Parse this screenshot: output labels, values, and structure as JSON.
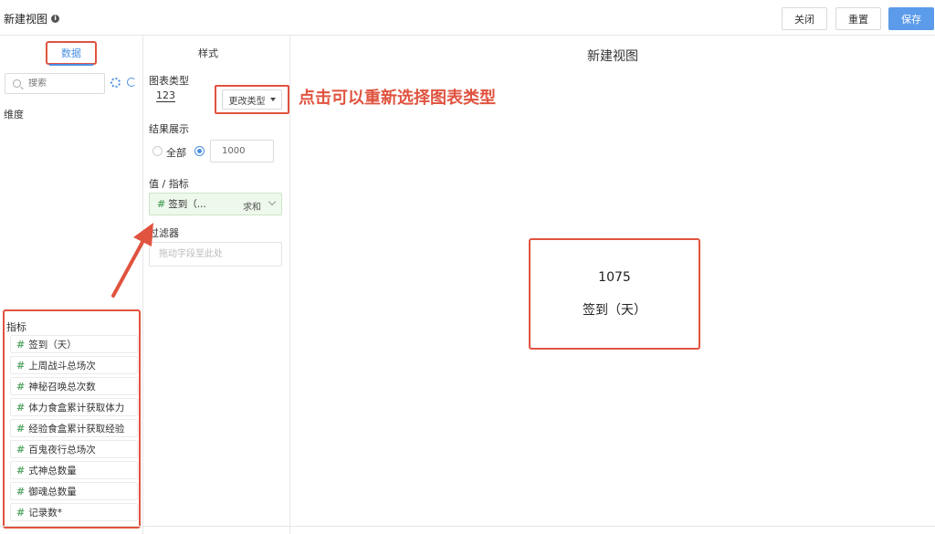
{
  "header": {
    "title": "新建视图",
    "buttons": {
      "close": "关闭",
      "reset": "重置",
      "save": "保存"
    },
    "save_color": "#5b9bea"
  },
  "left_panel": {
    "tab_data": "数据",
    "search_placeholder": "搜索",
    "dimension_label": "维度",
    "metrics_label": "指标",
    "metrics": [
      "签到（天）",
      "上周战斗总场次",
      "神秘召唤总次数",
      "体力食盒累计获取体力",
      "经验食盒累计获取经验",
      "百鬼夜行总场次",
      "式神总数量",
      "御魂总数量",
      "记录数*"
    ]
  },
  "config_panel": {
    "tab_style": "样式",
    "chart_type_label": "图表类型",
    "chart_type_value": "123",
    "change_type_button": "更改类型",
    "result_label": "结果展示",
    "all_option": "全部",
    "limit_value": "1000",
    "value_metric_label": "值 / 指标",
    "value_field": "签到（...",
    "aggregation": "求和",
    "filter_label": "过滤器",
    "filter_placeholder": "拖动字段至此处"
  },
  "annotation": "点击可以重新选择图表类型",
  "canvas": {
    "title": "新建视图",
    "kpi_value": "1075",
    "kpi_name": "签到（天）"
  },
  "colors": {
    "accent": "#4a8fe2",
    "highlight": "#e0533f",
    "field_green": "#5aa86a"
  },
  "icons": [
    "info-icon",
    "search-icon",
    "gear-icon",
    "refresh-icon",
    "hash-icon",
    "caret-down-icon",
    "chevron-down-icon",
    "arrow-icon"
  ]
}
